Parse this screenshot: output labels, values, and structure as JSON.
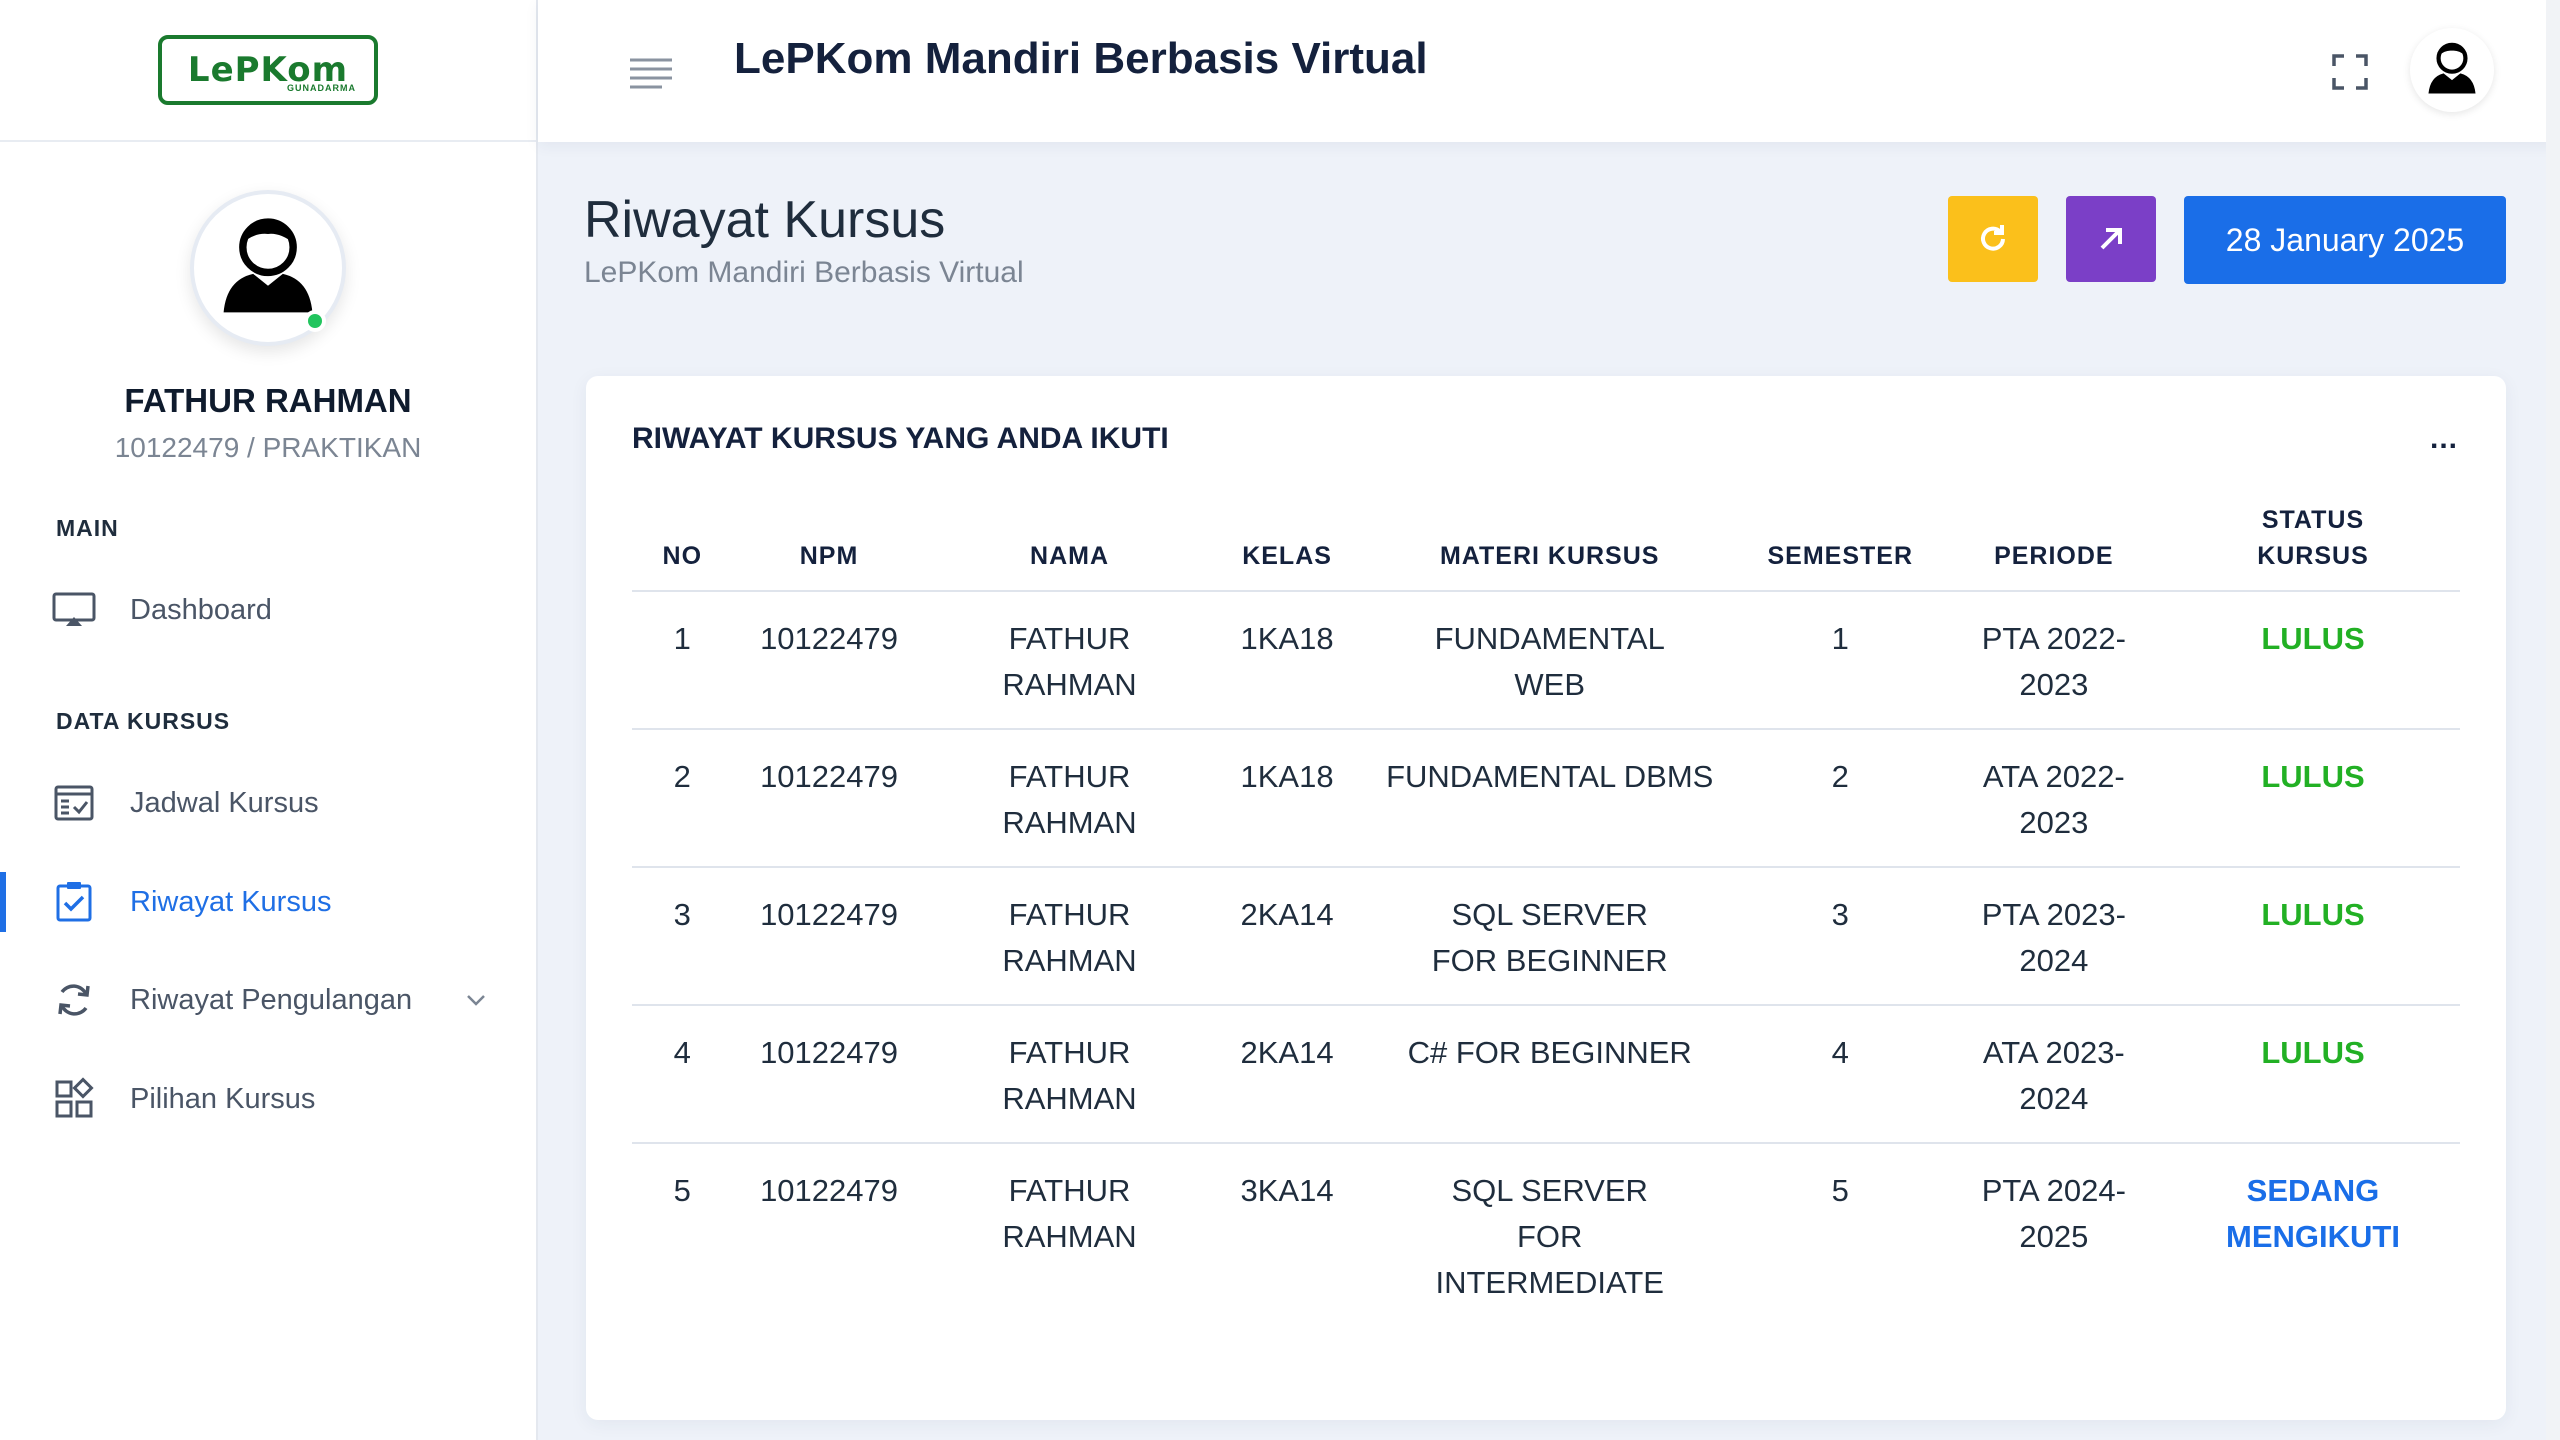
{
  "app": {
    "logo_text": "LePKom",
    "logo_sub": "GUNADARMA",
    "title": "LePKom Mandiri Berbasis Virtual"
  },
  "profile": {
    "name": "FATHUR RAHMAN",
    "sub": "10122479 / PRAKTIKAN"
  },
  "sidebar": {
    "section_main": "MAIN",
    "section_data": "DATA KURSUS",
    "items": [
      {
        "label": "Dashboard",
        "icon": "monitor-icon"
      },
      {
        "label": "Jadwal Kursus",
        "icon": "schedule-icon"
      },
      {
        "label": "Riwayat Kursus",
        "icon": "clipboard-check-icon",
        "active": true
      },
      {
        "label": "Riwayat Pengulangan",
        "icon": "refresh-icon"
      },
      {
        "label": "Pilihan Kursus",
        "icon": "apps-icon"
      }
    ]
  },
  "page": {
    "title": "Riwayat Kursus",
    "subtitle": "LePKom Mandiri Berbasis Virtual",
    "date": "28 January 2025"
  },
  "card": {
    "title": "RIWAYAT KURSUS YANG ANDA IKUTI",
    "more": "..."
  },
  "table": {
    "headers": [
      "NO",
      "NPM",
      "NAMA",
      "KELAS",
      "MATERI KURSUS",
      "SEMESTER",
      "PERIODE",
      "STATUS KURSUS"
    ],
    "rows": [
      {
        "no": "1",
        "npm": "10122479",
        "nama": "FATHUR RAHMAN",
        "kelas": "1KA18",
        "materi": "FUNDAMENTAL WEB",
        "semester": "1",
        "periode": "PTA 2022-2023",
        "status": "LULUS"
      },
      {
        "no": "2",
        "npm": "10122479",
        "nama": "FATHUR RAHMAN",
        "kelas": "1KA18",
        "materi": "FUNDAMENTAL DBMS",
        "semester": "2",
        "periode": "ATA 2022-2023",
        "status": "LULUS"
      },
      {
        "no": "3",
        "npm": "10122479",
        "nama": "FATHUR RAHMAN",
        "kelas": "2KA14",
        "materi": "SQL SERVER FOR BEGINNER",
        "semester": "3",
        "periode": "PTA 2023-2024",
        "status": "LULUS"
      },
      {
        "no": "4",
        "npm": "10122479",
        "nama": "FATHUR RAHMAN",
        "kelas": "2KA14",
        "materi": "C# FOR BEGINNER",
        "semester": "4",
        "periode": "ATA 2023-2024",
        "status": "LULUS"
      },
      {
        "no": "5",
        "npm": "10122479",
        "nama": "FATHUR RAHMAN",
        "kelas": "3KA14",
        "materi": "SQL SERVER FOR INTERMEDIATE",
        "semester": "5",
        "periode": "PTA 2024-2025",
        "status": "SEDANG MENGIKUTI"
      }
    ]
  },
  "colors": {
    "primary": "#1a6ee8",
    "warning": "#fbc01b",
    "purple": "#7b3fc7",
    "success": "#22b024",
    "logo_green": "#1a7a2e"
  }
}
